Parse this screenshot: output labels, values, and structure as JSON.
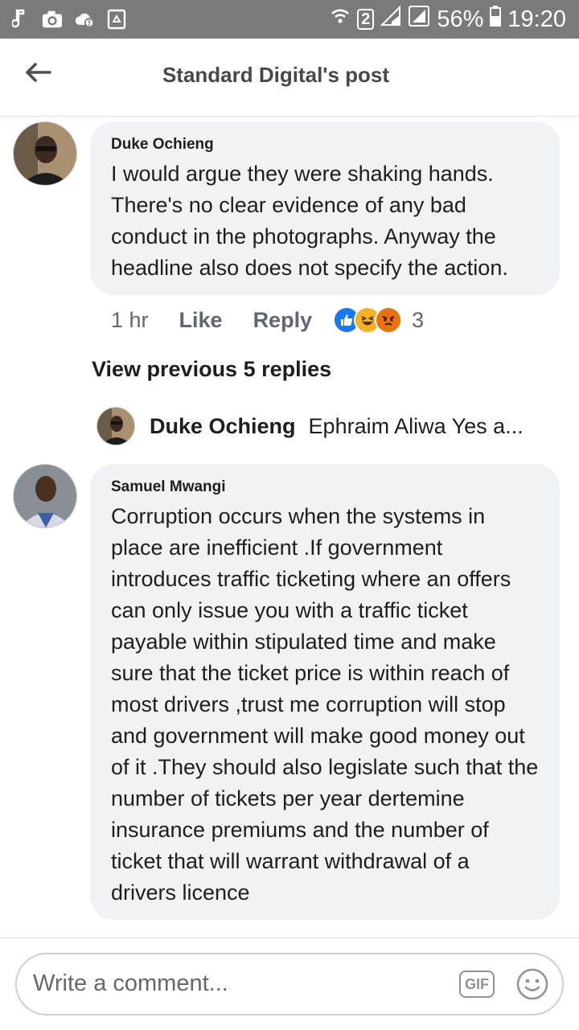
{
  "status_bar": {
    "sim_badge": "2",
    "battery": "56%",
    "time": "19:20",
    "icons": [
      "music-note-icon",
      "camera-icon",
      "cloud-alert-icon",
      "recycle-icon",
      "wifi-icon",
      "signal-icon",
      "battery-icon"
    ]
  },
  "header": {
    "title": "Standard Digital's post",
    "back_icon": "arrow-left-icon"
  },
  "comments": [
    {
      "author": "Duke Ochieng",
      "text": "I would argue they were shaking hands. There's no clear evidence of any bad conduct in the photographs. Anyway the headline also does not specify the action.",
      "time": "1 hr",
      "like_label": "Like",
      "reply_label": "Reply",
      "reactions": [
        "like",
        "haha",
        "angry"
      ],
      "reaction_count": "3"
    },
    {
      "author": "Samuel Mwangi",
      "text": "Corruption occurs when the systems in place are inefficient .If government introduces traffic ticketing where an offers can only issue you with a traffic ticket payable within stipulated time and make sure that the ticket price is within reach of most drivers ,trust me corruption will stop and government will make good money out of it .They should also legislate such that the number of tickets per year dertemine insurance premiums and the number of ticket that  will warrant withdrawal of a drivers licence"
    }
  ],
  "view_previous": "View previous 5 replies",
  "reply_preview": {
    "author": "Duke Ochieng",
    "snippet": "Ephraim Aliwa Yes a..."
  },
  "composer": {
    "placeholder": "Write a comment...",
    "gif_label": "GIF",
    "emoji_icon": "smiley-icon"
  },
  "colors": {
    "status_bar": "#7a7a7a",
    "bubble": "#f0f2f5",
    "like_blue": "#1877f2",
    "haha_yellow": "#f7b125",
    "angry_orange": "#e9710f"
  }
}
